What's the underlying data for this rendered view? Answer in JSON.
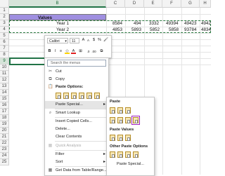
{
  "columns": {
    "b": "B",
    "c": "C",
    "d": "D",
    "e": "E",
    "f": "F",
    "g": "G",
    "h": "H"
  },
  "rows": [
    "1",
    "2",
    "3",
    "4",
    "5",
    "6",
    "7",
    "8",
    "9",
    "10",
    "11",
    "12",
    "13",
    "14",
    "15",
    "16",
    "17",
    "18",
    "19",
    "20",
    "21",
    "22",
    "23",
    "24",
    "25"
  ],
  "sheet": {
    "header_label": "Values",
    "row1_label": "Year 1",
    "row2_label": "Year 2",
    "row1_values": [
      "8584",
      "494",
      "3332",
      "49394",
      "49423",
      "4942"
    ],
    "row2_values": [
      "4853",
      "5893",
      "5852",
      "5858",
      "93784",
      "4834"
    ]
  },
  "mini_toolbar": {
    "font": "Calibri",
    "size": "11",
    "bold": "B",
    "italic": "I"
  },
  "context_menu": {
    "search_placeholder": "Search the menus",
    "cut": "Cut",
    "copy": "Copy",
    "paste_options": "Paste Options:",
    "paste_special": "Paste Special...",
    "smart_lookup": "Smart Lookup",
    "insert_copied": "Insert Copied Cells...",
    "delete": "Delete...",
    "clear": "Clear Contents",
    "quick_analysis": "Quick Analysis",
    "filter": "Filter",
    "sort": "Sort",
    "get_data": "Get Data from Table/Range..."
  },
  "submenu": {
    "paste": "Paste",
    "paste_values": "Paste Values",
    "other": "Other Paste Options",
    "paste_special": "Paste Special..."
  },
  "colors": {
    "header_fill": "#9f8fe0",
    "selection": "#217346",
    "highlight_box": "#a020c0"
  }
}
